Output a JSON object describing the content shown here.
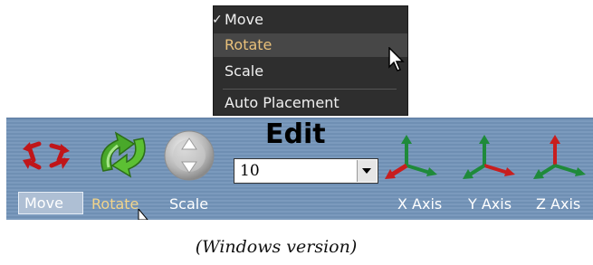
{
  "menu": {
    "items": [
      {
        "label": "Move",
        "checked": true
      },
      {
        "label": "Rotate",
        "hovered": true
      },
      {
        "label": "Scale"
      },
      {
        "label": "Auto Placement"
      }
    ],
    "check_glyph": "✓"
  },
  "toolbar": {
    "title": "Edit",
    "buttons": {
      "move": "Move",
      "rotate": "Rotate",
      "scale": "Scale",
      "x_axis": "X Axis",
      "y_axis": "Y Axis",
      "z_axis": "Z Axis"
    },
    "combo_value": "10"
  },
  "caption": "(Windows version)",
  "colors": {
    "menu_bg": "#2e2e2e",
    "menu_hover_text": "#e8c07a",
    "toolbar_bg": "#7392b7",
    "axis_green": "#1f8a3a",
    "axis_red": "#c81e1e"
  },
  "icons": [
    "move-arrows-icon",
    "rotate-arrows-icon",
    "scale-circle-icon",
    "x-axis-icon",
    "y-axis-icon",
    "z-axis-icon",
    "dropdown-arrow-icon",
    "mouse-cursor-icon"
  ]
}
